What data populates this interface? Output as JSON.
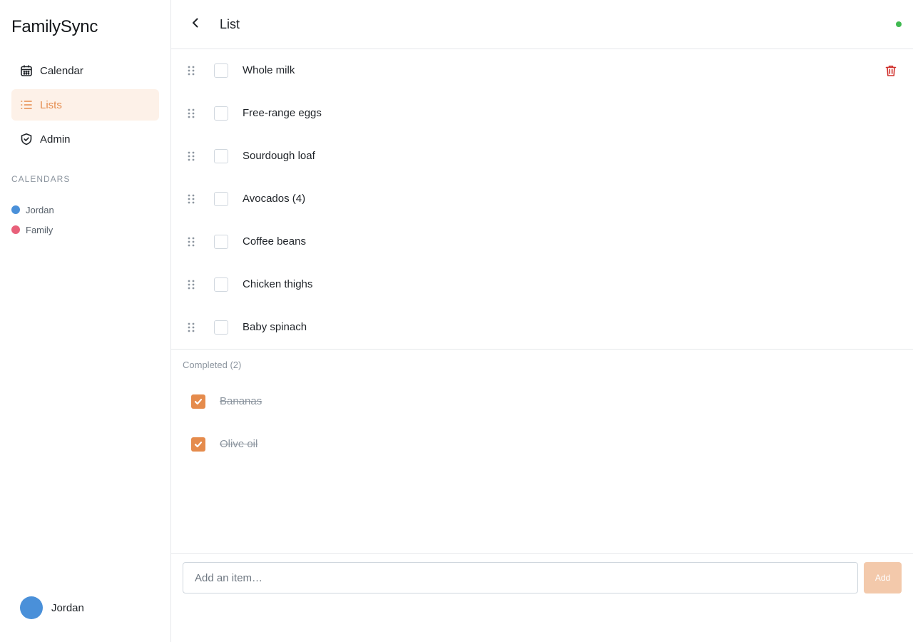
{
  "app": {
    "name": "FamilySync"
  },
  "sidebar": {
    "nav": [
      {
        "label": "Calendar",
        "icon": "calendar-icon",
        "active": false
      },
      {
        "label": "Lists",
        "icon": "list-icon",
        "active": true
      },
      {
        "label": "Admin",
        "icon": "shield-icon",
        "active": false
      }
    ],
    "calendars_heading": "CALENDARS",
    "calendars": [
      {
        "name": "Jordan",
        "color": "#4a90d9"
      },
      {
        "name": "Family",
        "color": "#e8607a"
      }
    ],
    "user": {
      "name": "Jordan",
      "avatar_color": "#4a90d9"
    }
  },
  "header": {
    "back_icon": "chevron-left-icon",
    "title": "List",
    "status_color": "#3fb950"
  },
  "items": [
    {
      "text": "Whole milk",
      "checked": false
    },
    {
      "text": "Free-range eggs",
      "checked": false
    },
    {
      "text": "Sourdough loaf",
      "checked": false
    },
    {
      "text": "Avocados (4)",
      "checked": false
    },
    {
      "text": "Coffee beans",
      "checked": false
    },
    {
      "text": "Chicken thighs",
      "checked": false
    },
    {
      "text": "Baby spinach",
      "checked": false
    }
  ],
  "completed": {
    "label": "Completed (2)",
    "items": [
      {
        "text": "Bananas",
        "checked": true
      },
      {
        "text": "Olive oil",
        "checked": true
      }
    ]
  },
  "add_form": {
    "placeholder": "Add an item…",
    "value": "",
    "button_label": "Add"
  },
  "colors": {
    "accent": "#e58b4c",
    "accent_light": "#fdf1e8",
    "danger": "#d0312d"
  }
}
